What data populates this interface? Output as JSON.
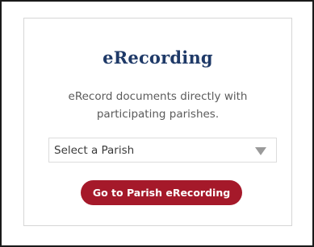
{
  "card": {
    "title": "eRecording",
    "description": "eRecord documents directly with participating parishes."
  },
  "parish_select": {
    "selected": "Select a Parish",
    "icon": "chevron-down-icon"
  },
  "action": {
    "label": "Go to Parish eRecording"
  },
  "colors": {
    "title": "#1f3a68",
    "button_bg": "#a5192a",
    "button_text": "#ffffff",
    "card_border": "#d6d6d6",
    "outer_border": "#1a1a1a"
  }
}
